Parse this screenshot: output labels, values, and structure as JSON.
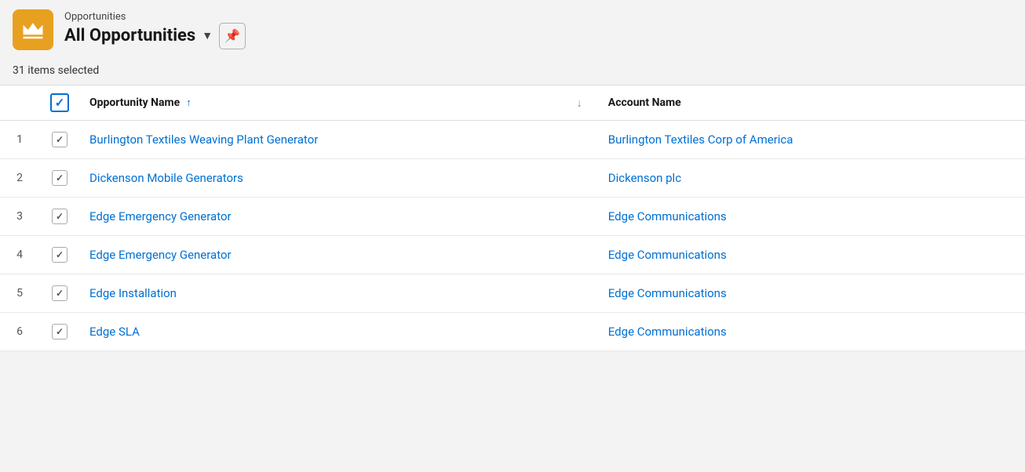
{
  "header": {
    "subtitle": "Opportunities",
    "title": "All Opportunities",
    "dropdown_label": "▼",
    "pin_icon": "📌"
  },
  "list_info": {
    "count_label": "31 items selected"
  },
  "table": {
    "columns": [
      {
        "key": "num",
        "label": ""
      },
      {
        "key": "check",
        "label": ""
      },
      {
        "key": "opportunity_name",
        "label": "Opportunity Name"
      },
      {
        "key": "sort_toggle",
        "label": ""
      },
      {
        "key": "account_name",
        "label": "Account Name"
      }
    ],
    "rows": [
      {
        "num": "1",
        "opportunity_name": "Burlington Textiles Weaving Plant Generator",
        "account_name": "Burlington Textiles Corp of America"
      },
      {
        "num": "2",
        "opportunity_name": "Dickenson Mobile Generators",
        "account_name": "Dickenson plc"
      },
      {
        "num": "3",
        "opportunity_name": "Edge Emergency Generator",
        "account_name": "Edge Communications"
      },
      {
        "num": "4",
        "opportunity_name": "Edge Emergency Generator",
        "account_name": "Edge Communications"
      },
      {
        "num": "5",
        "opportunity_name": "Edge Installation",
        "account_name": "Edge Communications"
      },
      {
        "num": "6",
        "opportunity_name": "Edge SLA",
        "account_name": "Edge Communications"
      }
    ]
  },
  "colors": {
    "accent": "#e8a020",
    "link": "#0070d2",
    "border": "#ddd"
  },
  "icons": {
    "crown": "crown",
    "pin": "📌",
    "check": "✓",
    "sort_up": "↑",
    "sort_down": "↓"
  }
}
